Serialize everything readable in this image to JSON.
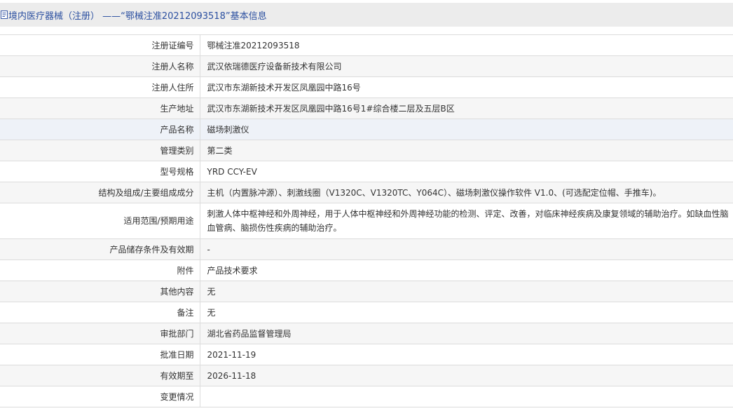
{
  "header": {
    "title": "境内医疗器械（注册） ——“鄂械注准20212093518”基本信息"
  },
  "rows": [
    {
      "label": "注册证编号",
      "value": "鄂械注准20212093518"
    },
    {
      "label": "注册人名称",
      "value": "武汉依瑞德医疗设备新技术有限公司"
    },
    {
      "label": "注册人住所",
      "value": "武汉市东湖新技术开发区凤凰园中路16号"
    },
    {
      "label": "生产地址",
      "value": "武汉市东湖新技术开发区凤凰园中路16号1#综合楼二层及五层B区"
    },
    {
      "label": "产品名称",
      "value": "磁场刺激仪"
    },
    {
      "label": "管理类别",
      "value": "第二类"
    },
    {
      "label": "型号规格",
      "value": "YRD CCY-EV"
    },
    {
      "label": "结构及组成/主要组成成分",
      "value": "主机（内置脉冲源）、刺激线圈（V1320C、V1320TC、Y064C）、磁场刺激仪操作软件 V1.0、(可选配定位帽、手推车)。"
    },
    {
      "label": "适用范围/预期用途",
      "value": "刺激人体中枢神经和外周神经，用于人体中枢神经和外周神经功能的检测、评定、改善，对临床神经疾病及康复领域的辅助治疗。如缺血性脑血管病、脑损伤性疾病的辅助治疗。"
    },
    {
      "label": "产品储存条件及有效期",
      "value": "-"
    },
    {
      "label": "附件",
      "value": "产品技术要求"
    },
    {
      "label": "其他内容",
      "value": "无"
    },
    {
      "label": "备注",
      "value": "无"
    },
    {
      "label": "审批部门",
      "value": "湖北省药品监督管理局"
    },
    {
      "label": "批准日期",
      "value": "2021-11-19"
    },
    {
      "label": "有效期至",
      "value": "2026-11-18"
    },
    {
      "label": "变更情况",
      "value": ""
    }
  ]
}
